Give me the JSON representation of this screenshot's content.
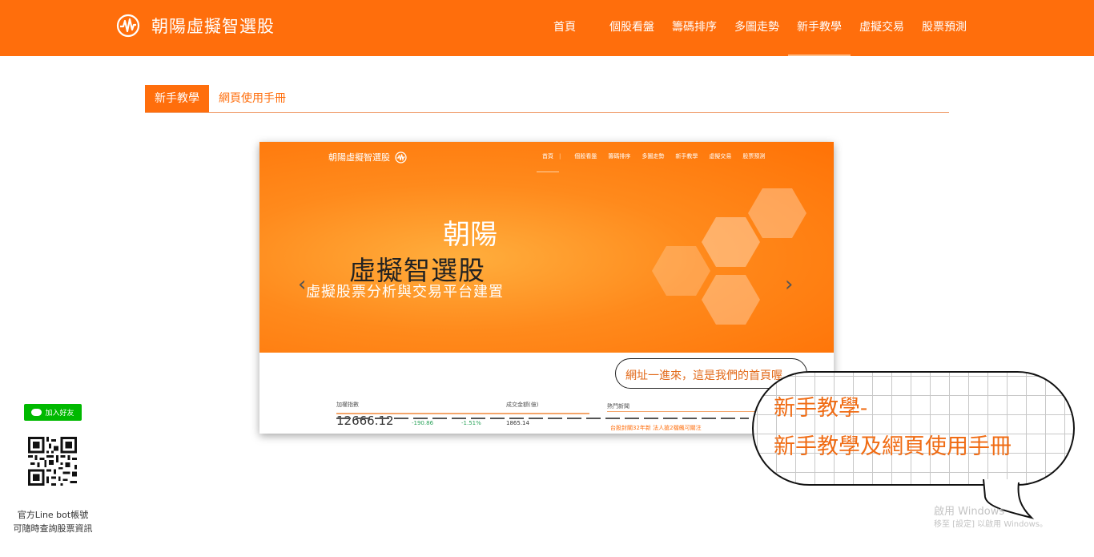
{
  "header": {
    "title": "朝陽虛擬智選股",
    "logo_icon": "pulse-circle-icon",
    "nav": [
      {
        "label": "首頁",
        "active": false
      },
      {
        "label": "個股看盤",
        "active": false
      },
      {
        "label": "籌碼排序",
        "active": false
      },
      {
        "label": "多圖走勢",
        "active": false
      },
      {
        "label": "新手教學",
        "active": true
      },
      {
        "label": "虛擬交易",
        "active": false
      },
      {
        "label": "股票預測",
        "active": false
      }
    ],
    "colors": {
      "primary": "#ff6e0c",
      "white": "#ffffff"
    }
  },
  "tabs": [
    {
      "label": "新手教學",
      "active": true
    },
    {
      "label": "網頁使用手冊",
      "active": false
    }
  ],
  "preview": {
    "brand": "朝陽虛擬智選股",
    "nav": [
      "首頁",
      "個股看盤",
      "籌碼排序",
      "多圖走勢",
      "新手教學",
      "虛擬交易",
      "股票預測"
    ],
    "hero_line1": "朝陽",
    "hero_line2": "虛擬智選股",
    "hero_line3": "虛擬股票分析與交易平台建置",
    "prev_arrow": "‹",
    "next_arrow": "›",
    "stats": {
      "index_label": "加權指數",
      "index_value": "12666.12",
      "change": "-190.86",
      "change_pct": "-1.51%",
      "volume_label": "成交金額(億)",
      "volume_value": "1865.14",
      "news_label": "熱門新聞",
      "news_text": "台股封關32年新 法人搶2檔飆可關注"
    },
    "callout": "網址一進來，這是我們的首頁喔"
  },
  "bubble": {
    "line1": "新手教學-",
    "line2": "新手教學及網頁使用手冊"
  },
  "watermark": {
    "line1": "啟用 Windows",
    "line2": "移至 [設定] 以啟用 Windows。"
  },
  "side": {
    "line_button": "加入好友",
    "caption1": "官方Line bot帳號",
    "caption2": "可隨時查詢股票資訊",
    "qr_icon": "qr-code-icon"
  }
}
